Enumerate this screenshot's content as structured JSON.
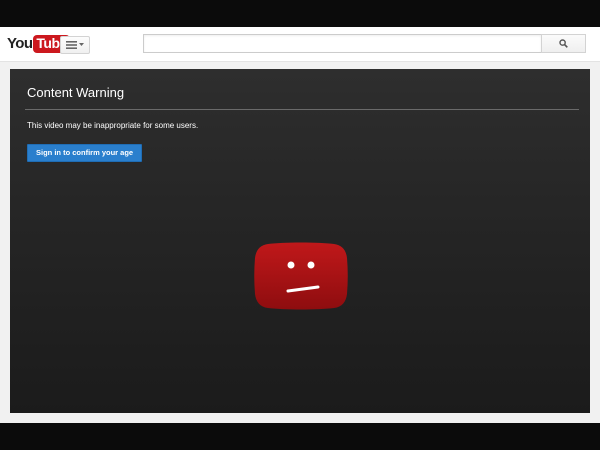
{
  "header": {
    "logo_you": "You",
    "logo_tube": "Tube",
    "guide_icon": "menu-list-icon",
    "search": {
      "value": "",
      "placeholder": ""
    },
    "search_icon": "search-icon"
  },
  "player": {
    "title": "Content Warning",
    "message": "This video may be inappropriate for some users.",
    "signin_label": "Sign in to confirm your age",
    "error_icon": "sad-tv-icon"
  },
  "colors": {
    "brand_red": "#cc181e",
    "button_blue": "#2a7fcd",
    "player_bg": "#262626"
  }
}
